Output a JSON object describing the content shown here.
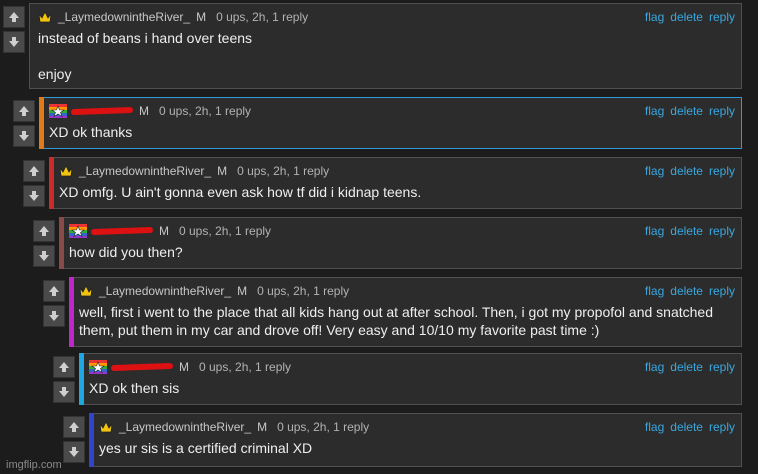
{
  "colors": {
    "link": "#38a8e0",
    "bars": [
      "#e07a1a",
      "#cc2b2b",
      "#8a4a4a",
      "#c026c9",
      "#1ea7e0",
      "#3344cc"
    ]
  },
  "actions": {
    "flag": "flag",
    "delete": "delete",
    "reply": "reply"
  },
  "comments": [
    {
      "user": "_LaymedownintheRiver_",
      "mod": "M",
      "meta": "0 ups, 2h, 1 reply",
      "body": [
        "instead of beans i hand over teens",
        "enjoy"
      ]
    },
    {
      "user": "",
      "mod": "M",
      "meta": "0 ups, 2h, 1 reply",
      "body": [
        "XD ok thanks"
      ]
    },
    {
      "user": "_LaymedownintheRiver_",
      "mod": "M",
      "meta": "0 ups, 2h, 1 reply",
      "body": [
        "XD omfg. U ain't gonna even ask how tf did i kidnap teens."
      ]
    },
    {
      "user": "",
      "mod": "M",
      "meta": "0 ups, 2h, 1 reply",
      "body": [
        "how did you then?"
      ]
    },
    {
      "user": "_LaymedownintheRiver_",
      "mod": "M",
      "meta": "0 ups, 2h, 1 reply",
      "body": [
        "well, first i went to the place that all kids hang out at after school. Then, i got my propofol and snatched them, put them in my car and drove off! Very easy and 10/10 my favorite past time :)"
      ]
    },
    {
      "user": "",
      "mod": "M",
      "meta": "0 ups, 2h, 1 reply",
      "body": [
        "XD ok then sis"
      ]
    },
    {
      "user": "_LaymedownintheRiver_",
      "mod": "M",
      "meta": "0 ups, 2h, 1 reply",
      "body": [
        "yes ur sis is a certified criminal XD"
      ]
    }
  ],
  "watermark": "imgflip.com"
}
